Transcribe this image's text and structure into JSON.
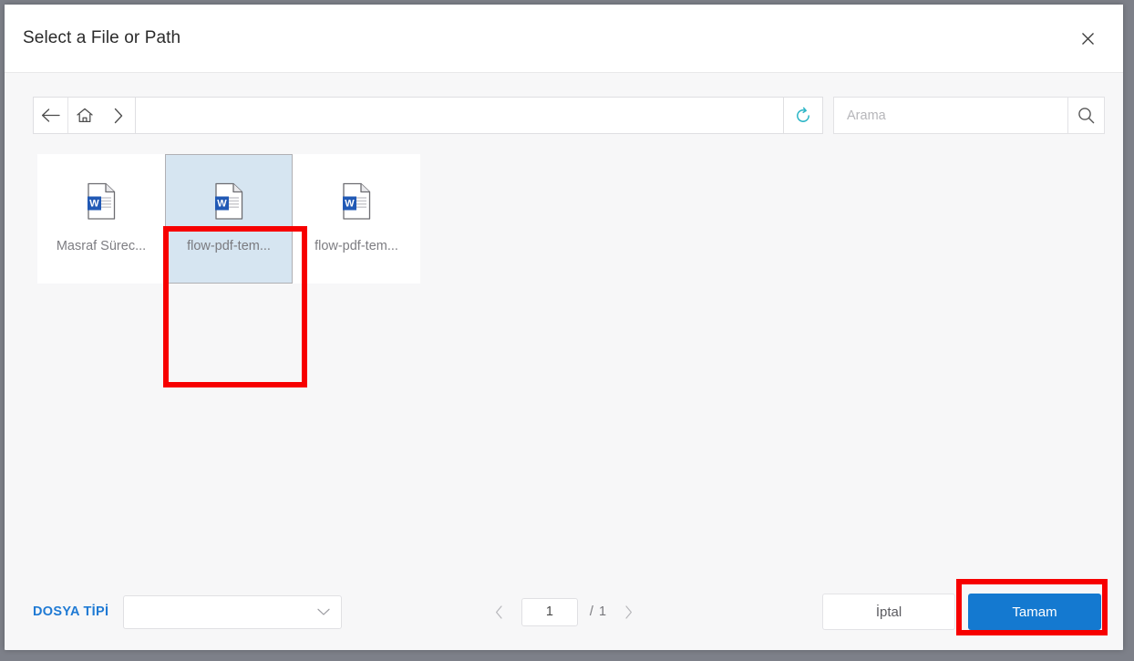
{
  "dialog": {
    "title": "Select a File or Path",
    "close_icon": "close-icon"
  },
  "toolbar": {
    "back_icon": "arrow-left-icon",
    "home_icon": "home-icon",
    "forward_icon": "chevron-right-icon",
    "path_value": "",
    "path_placeholder": "",
    "refresh_icon": "refresh-icon",
    "refresh_color": "#2bb5c6",
    "search_value": "",
    "search_placeholder": "Arama",
    "search_icon": "search-icon"
  },
  "files": [
    {
      "name": "Masraf Sürec...",
      "type": "word-document",
      "selected": false
    },
    {
      "name": "flow-pdf-tem...",
      "type": "word-document",
      "selected": true
    },
    {
      "name": "flow-pdf-tem...",
      "type": "word-document",
      "selected": false
    }
  ],
  "footer": {
    "filetype_label": "DOSYA TİPİ",
    "filetype_label_color": "#1f7ad4",
    "filetype_value": "",
    "filetype_chevron_icon": "chevron-down-icon",
    "prev_icon": "chevron-left-icon",
    "next_icon": "chevron-right-icon",
    "page_current": "1",
    "page_separator": "/",
    "page_total": "1",
    "cancel_label": "İptal",
    "ok_label": "Tamam",
    "ok_color": "#1479d0"
  },
  "annotations": {
    "highlight_color": "#f70000",
    "targets": [
      "selected-file-card",
      "ok-button"
    ]
  }
}
